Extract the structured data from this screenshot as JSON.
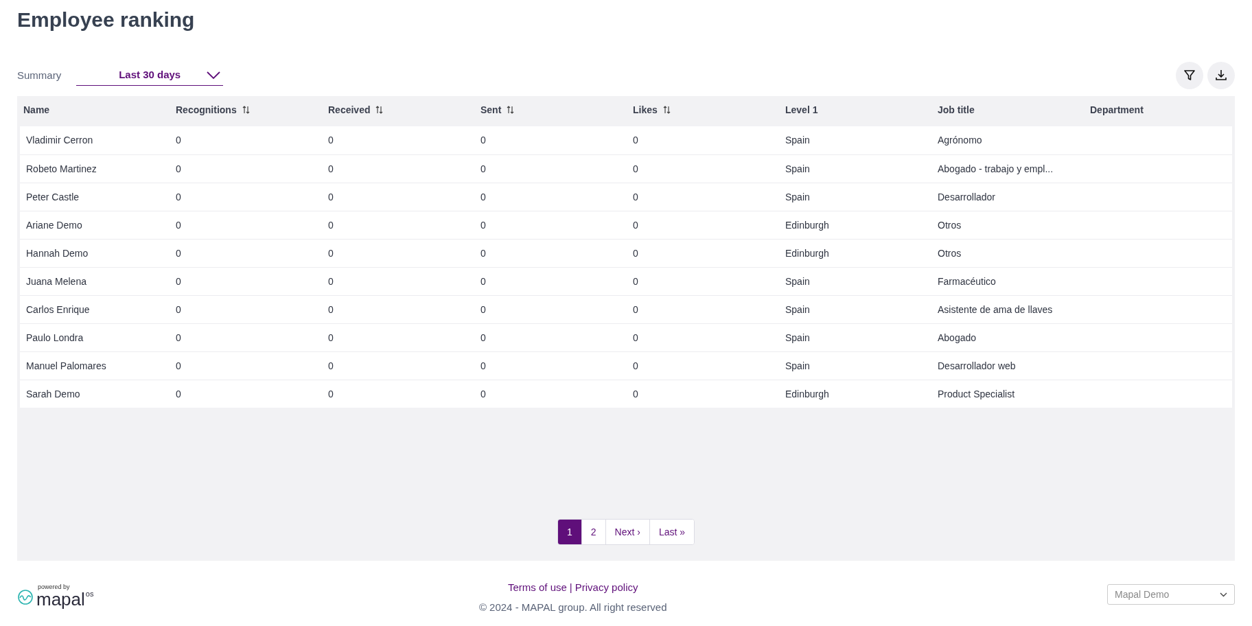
{
  "page_title": "Employee ranking",
  "summary": {
    "label": "Summary",
    "value": "Last 30 days"
  },
  "toolbar": {
    "buttons": [
      {
        "kind": "filter"
      },
      {
        "kind": "download"
      }
    ]
  },
  "table": {
    "columns": [
      {
        "label": "Name",
        "sortable": false
      },
      {
        "label": "Recognitions",
        "sortable": true
      },
      {
        "label": "Received",
        "sortable": true
      },
      {
        "label": "Sent",
        "sortable": true
      },
      {
        "label": "Likes",
        "sortable": true
      },
      {
        "label": "Level 1",
        "sortable": false
      },
      {
        "label": "Job title",
        "sortable": false
      },
      {
        "label": "Department",
        "sortable": false
      }
    ],
    "rows": [
      [
        "Vladimir Cerron",
        "0",
        "0",
        "0",
        "0",
        "Spain",
        "Agrónomo"
      ],
      [
        "Robeto Martinez",
        "0",
        "0",
        "0",
        "0",
        "Spain",
        "Abogado - trabajo y empl..."
      ],
      [
        "Peter Castle",
        "0",
        "0",
        "0",
        "0",
        "Spain",
        "Desarrollador"
      ],
      [
        "Ariane Demo",
        "0",
        "0",
        "0",
        "0",
        "Edinburgh",
        "Otros"
      ],
      [
        "Hannah Demo",
        "0",
        "0",
        "0",
        "0",
        "Edinburgh",
        "Otros"
      ],
      [
        "Juana Melena",
        "0",
        "0",
        "0",
        "0",
        "Spain",
        "Farmacéutico"
      ],
      [
        "Carlos Enrique",
        "0",
        "0",
        "0",
        "0",
        "Spain",
        "Asistente de ama de llaves"
      ],
      [
        "Paulo Londra",
        "0",
        "0",
        "0",
        "0",
        "Spain",
        "Abogado"
      ],
      [
        "Manuel Palomares",
        "0",
        "0",
        "0",
        "0",
        "Spain",
        "Desarrollador web"
      ],
      [
        "Sarah Demo",
        "0",
        "0",
        "0",
        "0",
        "Edinburgh",
        "Product Specialist"
      ]
    ]
  },
  "pagination": [
    {
      "label": "1",
      "selected": true
    },
    {
      "label": "2",
      "selected": false
    },
    {
      "label": "Next ›",
      "selected": false
    },
    {
      "label": "Last »",
      "selected": false
    }
  ],
  "footer": {
    "logo": {
      "tagline": "powered by",
      "wordmark": "mapal",
      "suffix": "os"
    },
    "links": [
      "Terms of use",
      "Privacy policy"
    ],
    "separator": "|",
    "copyright": "© 2024 - MAPAL group. All right reserved",
    "account_select": "Mapal Demo"
  }
}
